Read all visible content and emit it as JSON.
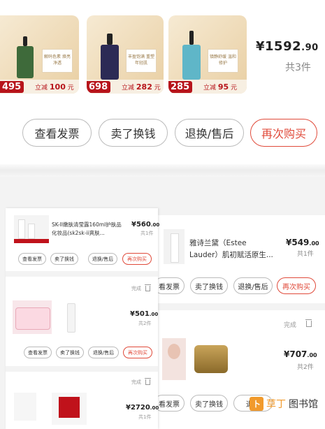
{
  "top_order": {
    "items": [
      {
        "price_tag": "495",
        "discount_prefix": "立减",
        "discount_value": "100",
        "discount_unit": "元",
        "note": "解码色素 焕亮净透"
      },
      {
        "price_tag": "698",
        "discount_prefix": "立减",
        "discount_value": "282",
        "discount_unit": "元",
        "note": "丰盈饱满 重塑年轻肌"
      },
      {
        "price_tag": "285",
        "discount_prefix": "立减",
        "discount_value": "95",
        "discount_unit": "元",
        "note": "镇静舒缓 温和修护"
      }
    ],
    "total_symbol": "¥",
    "total_int": "1592",
    "total_dec": ".90",
    "count": "共3件",
    "buttons": [
      "查看发票",
      "卖了换钱",
      "退换/售后",
      "再次购买"
    ]
  },
  "left_orders": [
    {
      "title": "SK-II嫩肤清莹露160ml护肤品化妆品(sk2sk-ii爽肤...",
      "price_int": "¥560",
      "price_dec": ".00",
      "count": "共1件",
      "status": "",
      "buttons": [
        "查看发票",
        "卖了换钱",
        "退换/售后",
        "再次购买"
      ]
    },
    {
      "title": "",
      "price_int": "¥501",
      "price_dec": ".00",
      "count": "共2件",
      "status": "完成",
      "buttons": [
        "查看发票",
        "卖了换钱",
        "退换/售后",
        "再次购买"
      ]
    },
    {
      "title": "",
      "price_int": "¥2720",
      "price_dec": ".00",
      "count": "共1件",
      "status": "完成",
      "buttons": []
    }
  ],
  "right_orders": [
    {
      "title": "雅诗兰黛（Estee Lauder）肌初赋活原生...",
      "price_int": "¥549",
      "price_dec": ".00",
      "count": "共1件",
      "status": "",
      "buttons": [
        "看发票",
        "卖了换钱",
        "退换/售后",
        "再次购买"
      ]
    },
    {
      "title": "",
      "price_int": "¥707",
      "price_dec": ".00",
      "count": "共2件",
      "status": "完成",
      "buttons": [
        "看发票",
        "卖了换钱",
        "退换"
      ]
    }
  ],
  "watermark": {
    "logo": "卜",
    "text1": "草丁",
    "text2": "图书馆"
  },
  "colors": {
    "accent": "#e04a3a",
    "price_tag_bg": "#b7141b",
    "thumb_bg": "#efd9b2"
  }
}
